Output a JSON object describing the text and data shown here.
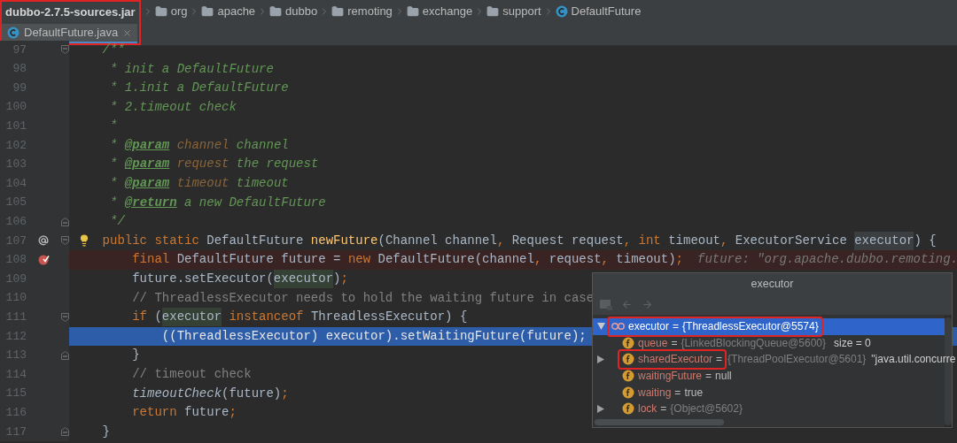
{
  "breadcrumb": {
    "highlighted": true,
    "items": [
      {
        "kind": "jar",
        "label": "dubbo-2.7.5-sources.jar"
      },
      {
        "kind": "package",
        "label": "org"
      },
      {
        "kind": "package",
        "label": "apache"
      },
      {
        "kind": "package",
        "label": "dubbo"
      },
      {
        "kind": "package",
        "label": "remoting"
      },
      {
        "kind": "package",
        "label": "exchange"
      },
      {
        "kind": "package",
        "label": "support"
      },
      {
        "kind": "class",
        "label": "DefaultFuture"
      }
    ]
  },
  "tabs": [
    {
      "label": "DefaultFuture.java",
      "selected": true
    }
  ],
  "editor": {
    "lines": [
      {
        "number": "97",
        "fold_start": true,
        "tokens": [
          {
            "kind": "doc",
            "text": "    /**"
          }
        ]
      },
      {
        "number": "98",
        "tokens": [
          {
            "kind": "doc",
            "text": "     * init a DefaultFuture"
          }
        ]
      },
      {
        "number": "99",
        "tokens": [
          {
            "kind": "doc",
            "text": "     * 1.init a DefaultFuture"
          }
        ]
      },
      {
        "number": "100",
        "tokens": [
          {
            "kind": "doc",
            "text": "     * 2.timeout check"
          }
        ]
      },
      {
        "number": "101",
        "tokens": [
          {
            "kind": "doc",
            "text": "     *"
          }
        ]
      },
      {
        "number": "102",
        "tokens": [
          {
            "kind": "doc",
            "text": "     * "
          },
          {
            "kind": "doctag",
            "text": "@param"
          },
          {
            "kind": "docparam",
            "text": " channel"
          },
          {
            "kind": "doc",
            "text": " channel"
          }
        ]
      },
      {
        "number": "103",
        "tokens": [
          {
            "kind": "doc",
            "text": "     * "
          },
          {
            "kind": "doctag",
            "text": "@param"
          },
          {
            "kind": "docparam",
            "text": " request"
          },
          {
            "kind": "doc",
            "text": " the request"
          }
        ]
      },
      {
        "number": "104",
        "tokens": [
          {
            "kind": "doc",
            "text": "     * "
          },
          {
            "kind": "doctag",
            "text": "@param"
          },
          {
            "kind": "docparam",
            "text": " timeout"
          },
          {
            "kind": "doc",
            "text": " timeout"
          }
        ]
      },
      {
        "number": "105",
        "tokens": [
          {
            "kind": "doc",
            "text": "     * "
          },
          {
            "kind": "doctag",
            "text": "@return"
          },
          {
            "kind": "doc",
            "text": " a new DefaultFuture"
          }
        ]
      },
      {
        "number": "106",
        "fold_end": true,
        "tokens": [
          {
            "kind": "doc",
            "text": "     */"
          }
        ]
      },
      {
        "number": "107",
        "overrides": true,
        "fold_start": true,
        "bulb": true,
        "tokens": [
          {
            "kind": "kw",
            "text": "    public static "
          },
          {
            "kind": "plain",
            "text": "DefaultFuture "
          },
          {
            "kind": "method",
            "text": "newFuture"
          },
          {
            "kind": "plain",
            "text": "(Channel channel"
          },
          {
            "kind": "kw",
            "text": ", "
          },
          {
            "kind": "plain",
            "text": "Request request"
          },
          {
            "kind": "kw",
            "text": ", int "
          },
          {
            "kind": "plain",
            "text": "timeout"
          },
          {
            "kind": "kw",
            "text": ", "
          },
          {
            "kind": "plain",
            "text": "ExecutorService "
          },
          {
            "kind": "decl",
            "text": "executor"
          },
          {
            "kind": "plain",
            "text": ") {"
          }
        ]
      },
      {
        "number": "108",
        "breakpoint": true,
        "tokens": [
          {
            "kind": "kw",
            "text": "        final "
          },
          {
            "kind": "plain",
            "text": "DefaultFuture future = "
          },
          {
            "kind": "kw",
            "text": "new "
          },
          {
            "kind": "plain",
            "text": "DefaultFuture(channel"
          },
          {
            "kind": "kw",
            "text": ", "
          },
          {
            "kind": "plain",
            "text": "request"
          },
          {
            "kind": "kw",
            "text": ", "
          },
          {
            "kind": "plain",
            "text": "timeout)"
          },
          {
            "kind": "kw",
            "text": ";"
          },
          {
            "kind": "hint",
            "text": "future: \"org.apache.dubbo.remoting."
          }
        ]
      },
      {
        "number": "109",
        "tokens": [
          {
            "kind": "plain",
            "text": "        future.setExecutor("
          },
          {
            "kind": "usage",
            "text": "executor"
          },
          {
            "kind": "plain",
            "text": ")"
          },
          {
            "kind": "kw",
            "text": ";"
          }
        ]
      },
      {
        "number": "110",
        "tokens": [
          {
            "kind": "comment",
            "text": "        // ThreadlessExecutor needs to hold the waiting future in case"
          }
        ]
      },
      {
        "number": "111",
        "fold_start": true,
        "tokens": [
          {
            "kind": "kw",
            "text": "        if "
          },
          {
            "kind": "plain",
            "text": "("
          },
          {
            "kind": "usage",
            "text": "executor"
          },
          {
            "kind": "kw",
            "text": " instanceof "
          },
          {
            "kind": "plain",
            "text": "ThreadlessExecutor) {"
          }
        ]
      },
      {
        "number": "112",
        "current": true,
        "tokens": [
          {
            "kind": "plain",
            "text": "            ((ThreadlessExecutor) executor).setWaitingFuture(future);"
          }
        ]
      },
      {
        "number": "113",
        "fold_end": true,
        "tokens": [
          {
            "kind": "plain",
            "text": "        }"
          }
        ]
      },
      {
        "number": "114",
        "tokens": [
          {
            "kind": "comment",
            "text": "        // timeout check"
          }
        ]
      },
      {
        "number": "115",
        "tokens": [
          {
            "kind": "static",
            "text": "        timeoutCheck"
          },
          {
            "kind": "plain",
            "text": "(future)"
          },
          {
            "kind": "kw",
            "text": ";"
          }
        ]
      },
      {
        "number": "116",
        "tokens": [
          {
            "kind": "kw",
            "text": "        return "
          },
          {
            "kind": "plain",
            "text": "future"
          },
          {
            "kind": "kw",
            "text": ";"
          }
        ]
      },
      {
        "number": "117",
        "fold_end": true,
        "tokens": [
          {
            "kind": "plain",
            "text": "    }"
          }
        ]
      }
    ]
  },
  "popup": {
    "title": "executor",
    "tree": [
      {
        "kind": "object",
        "name": "executor",
        "operator": "=",
        "value": "{ThreadlessExecutor@5574}",
        "expanded": true,
        "selected": true,
        "highlighted": true,
        "children": [
          {
            "kind": "field",
            "name": "queue",
            "operator": "=",
            "value": "{LinkedBlockingQueue@5600}",
            "reference": true,
            "extra": "size = 0",
            "selected": false,
            "highlighted": false
          },
          {
            "kind": "field",
            "name": "sharedExecutor",
            "operator": "=",
            "value": "{ThreadPoolExecutor@5601}",
            "reference": true,
            "extra": "\"java.util.concurre",
            "expanded": false,
            "selected": false,
            "highlighted": true
          },
          {
            "kind": "field",
            "name": "waitingFuture",
            "operator": "=",
            "value": "null",
            "reference": false,
            "selected": false,
            "highlighted": false
          },
          {
            "kind": "field",
            "name": "waiting",
            "operator": "=",
            "value": "true",
            "reference": false,
            "selected": false,
            "highlighted": false
          },
          {
            "kind": "field",
            "name": "lock",
            "operator": "=",
            "value": "{Object@5602}",
            "reference": true,
            "expanded": false,
            "selected": false,
            "highlighted": false
          }
        ]
      }
    ]
  }
}
